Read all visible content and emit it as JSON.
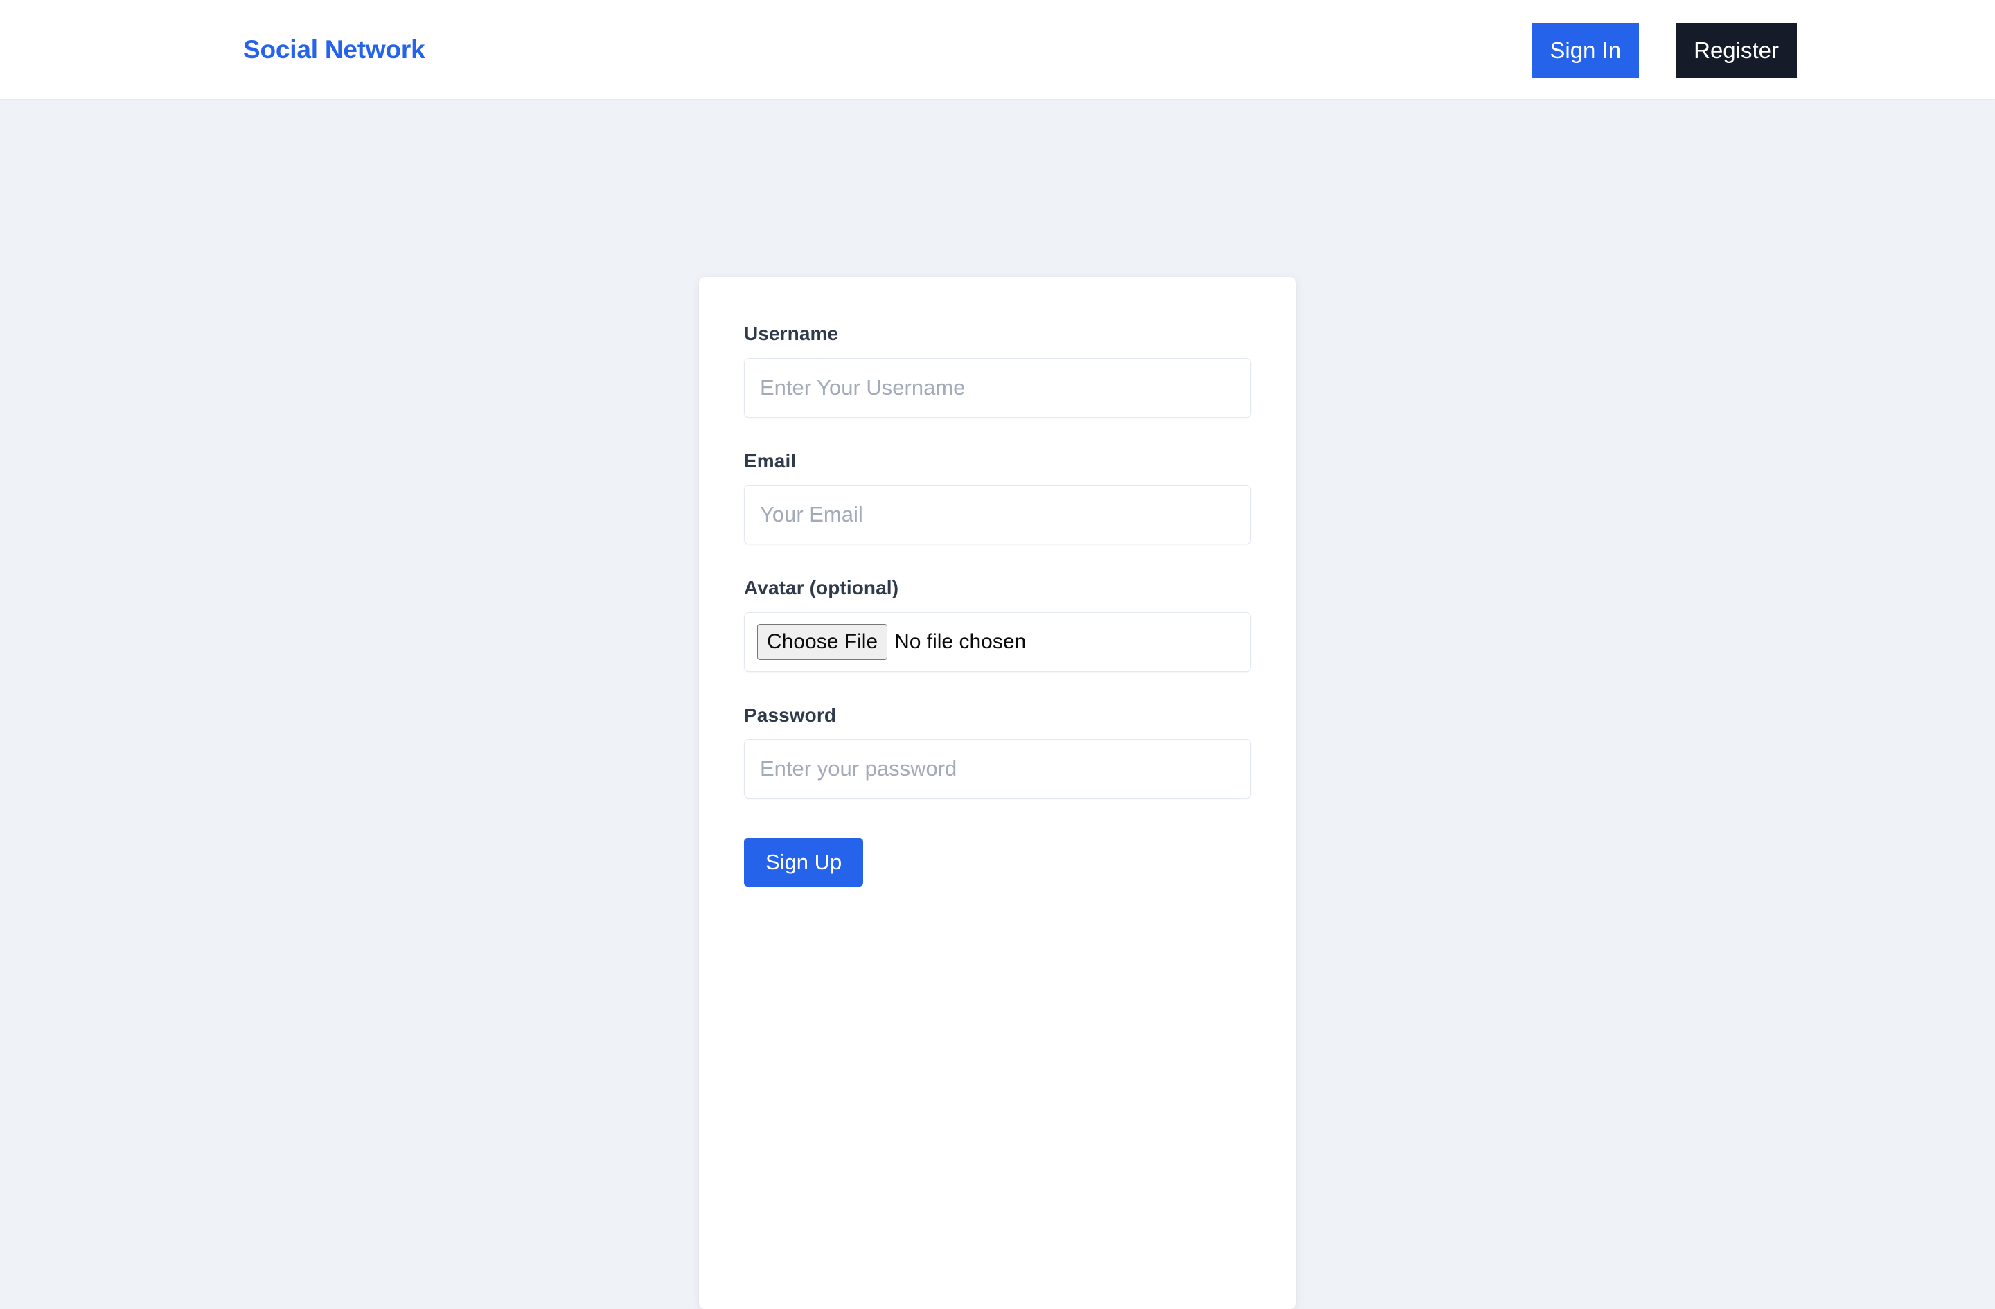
{
  "navbar": {
    "brand": "Social Network",
    "actions": [
      {
        "label": "Sign In",
        "variant": "primary",
        "color": "#2563eb"
      },
      {
        "label": "Register",
        "variant": "dark",
        "color": "#151b28"
      }
    ]
  },
  "form": {
    "fields": [
      {
        "label": "Username",
        "type": "text",
        "value": "",
        "placeholder": "Enter Your Username"
      },
      {
        "label": "Email",
        "type": "email",
        "value": "",
        "placeholder": "Your Email"
      },
      {
        "label": "Avatar (optional)",
        "type": "file",
        "button_label": "Choose File",
        "status": "No file chosen"
      },
      {
        "label": "Password",
        "type": "password",
        "value": "",
        "placeholder": "Enter your password"
      }
    ],
    "submit_label": "Sign Up"
  },
  "theme": {
    "accent": "#2563eb",
    "dark": "#151b28",
    "page_background": "#eff3f8",
    "card_background": "#ffffff",
    "label_color": "#2f3a4c",
    "placeholder_color": "#a3aab8"
  }
}
